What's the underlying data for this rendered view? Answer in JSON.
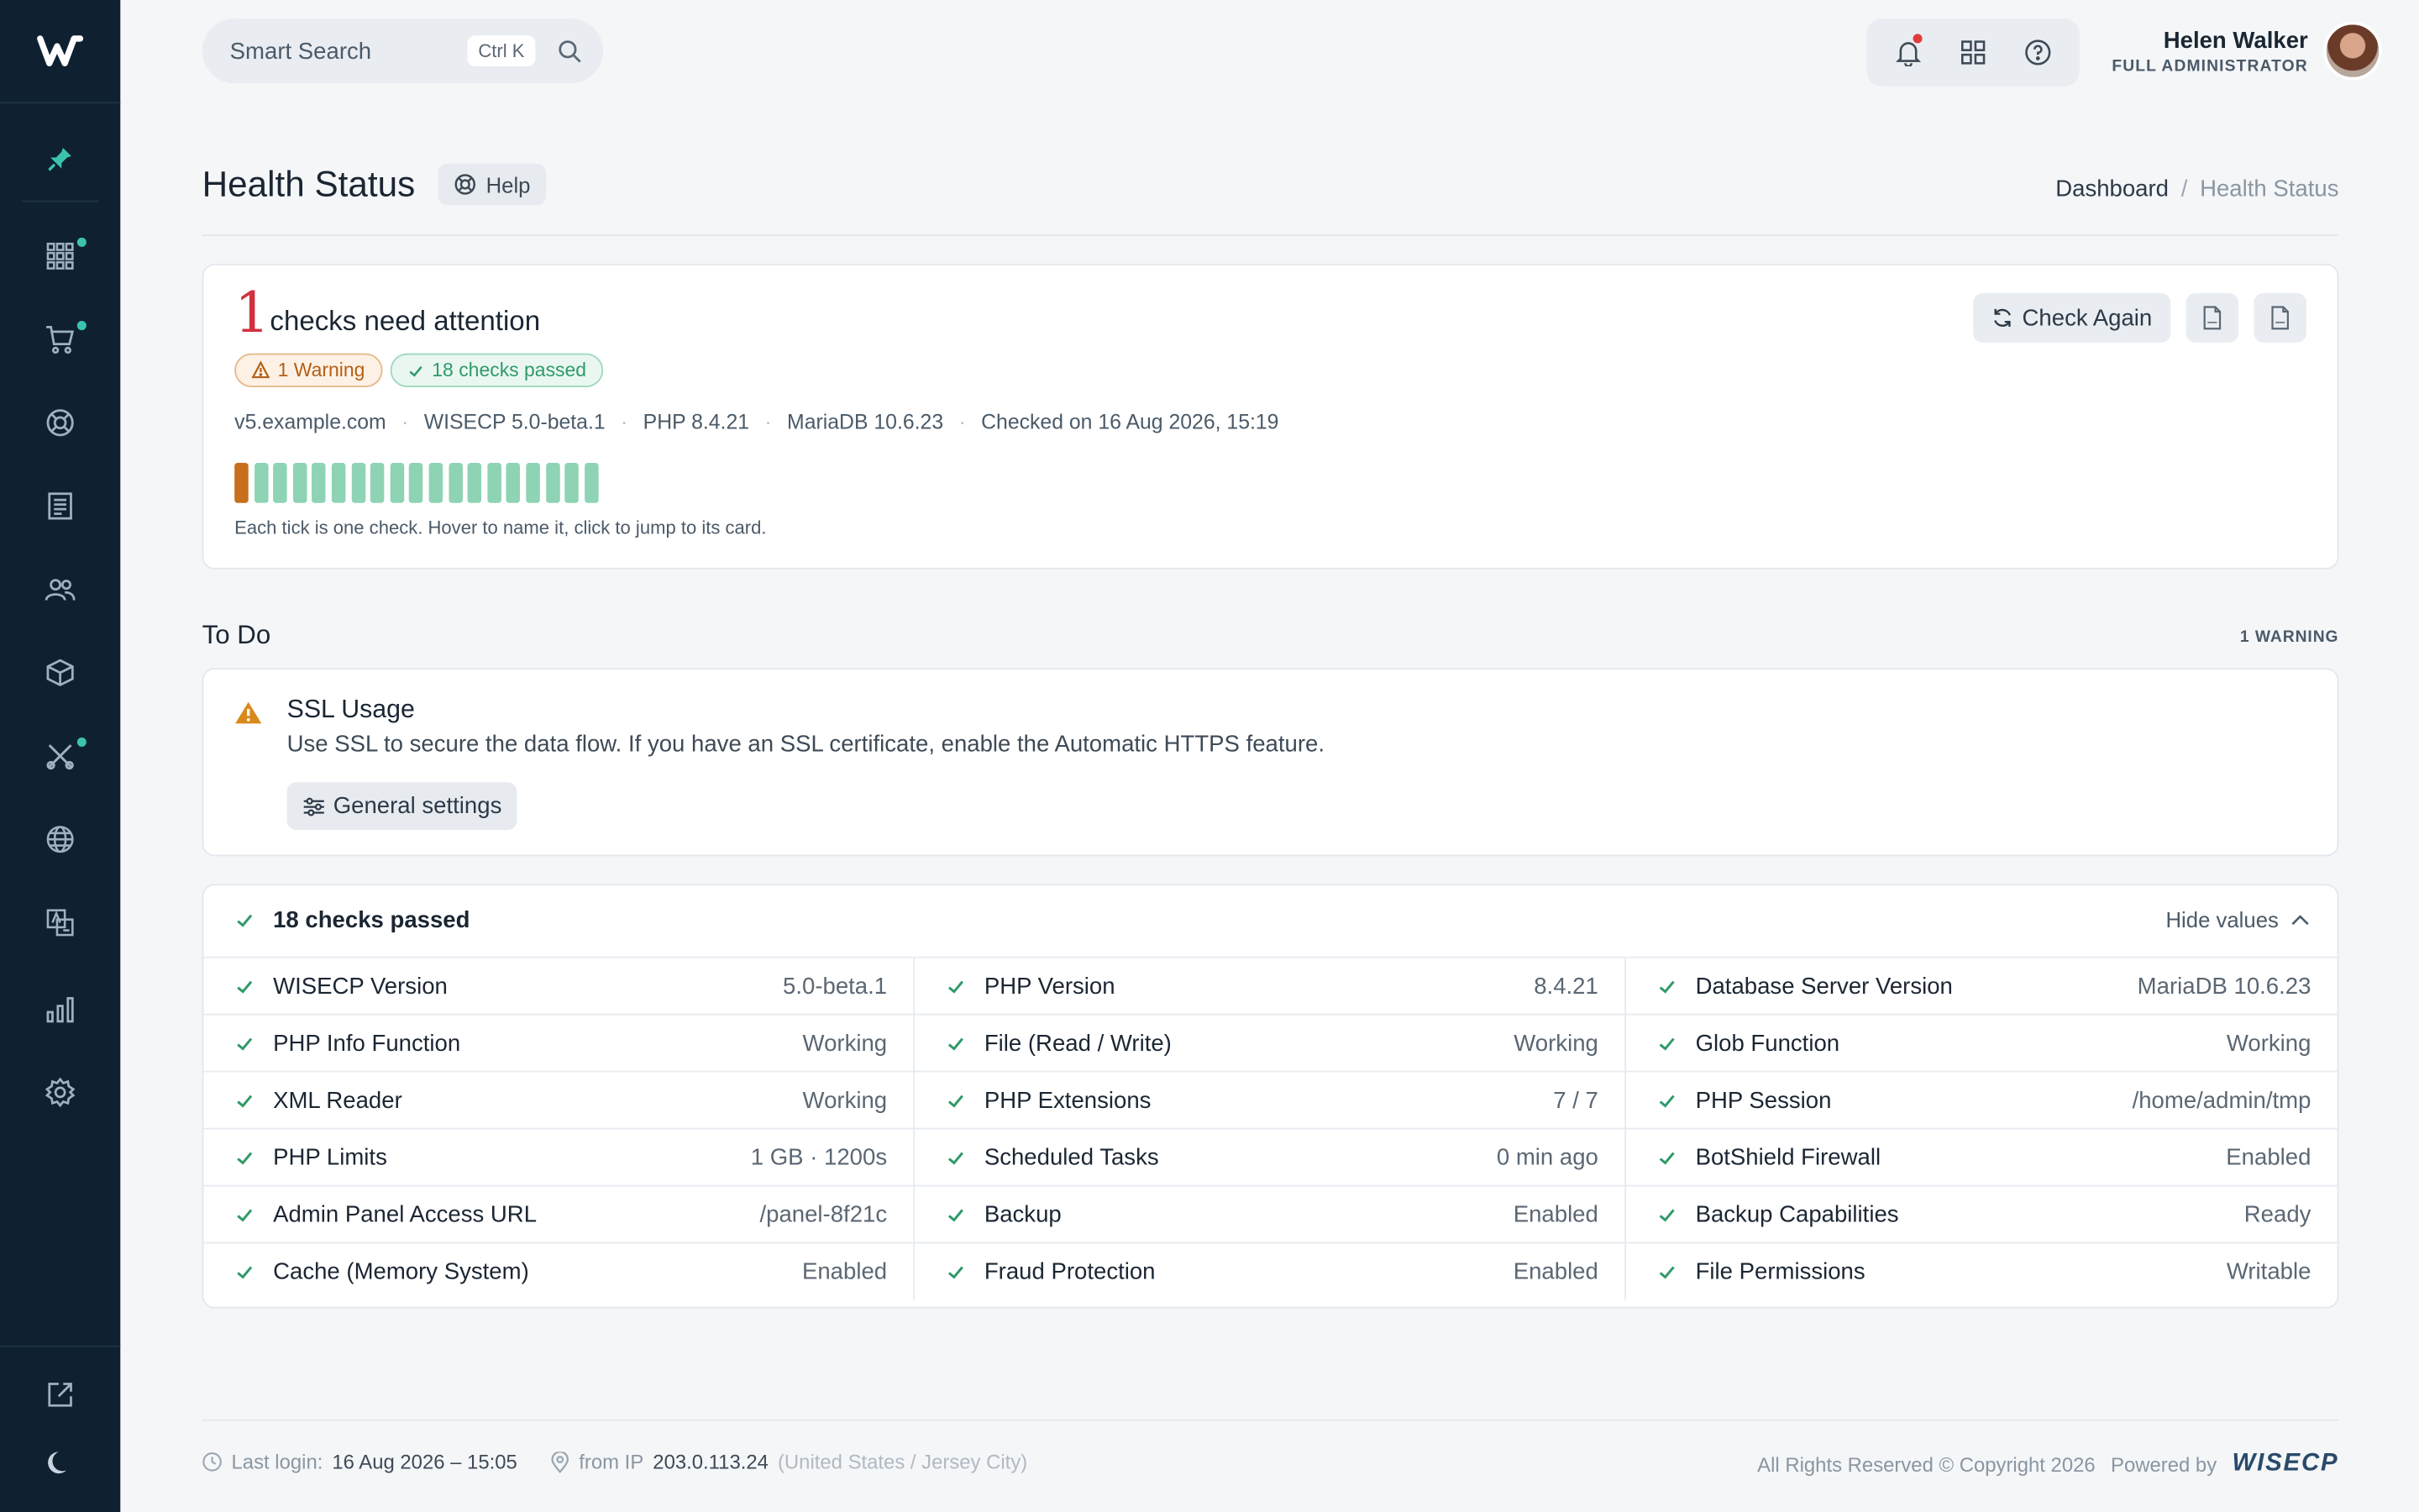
{
  "header": {
    "search_placeholder": "Smart Search",
    "search_shortcut": "Ctrl K",
    "user_name": "Helen Walker",
    "user_role": "FULL ADMINISTRATOR"
  },
  "page": {
    "title": "Health Status",
    "help_label": "Help",
    "breadcrumb": [
      "Dashboard",
      "/",
      "Health Status"
    ]
  },
  "summary": {
    "count": "1",
    "headline": "checks need attention",
    "warning_badge": "1 Warning",
    "passed_badge": "18 checks passed",
    "meta": [
      "v5.example.com",
      "WISECP 5.0-beta.1",
      "PHP 8.4.21",
      "MariaDB 10.6.23",
      "Checked on 16 Aug 2026, 15:19"
    ],
    "ticks": {
      "warning": 1,
      "passed": 18
    },
    "hint": "Each tick is one check. Hover to name it, click to jump to its card.",
    "check_again": "Check Again"
  },
  "todo": {
    "heading": "To Do",
    "count_label": "1 WARNING",
    "item_title": "SSL Usage",
    "item_desc": "Use SSL to secure the data flow. If you have an SSL certificate, enable the Automatic HTTPS feature.",
    "item_button": "General settings"
  },
  "passed": {
    "heading": "18 checks passed",
    "toggle": "Hide values",
    "checks": [
      {
        "label": "WISECP Version",
        "value": "5.0-beta.1"
      },
      {
        "label": "PHP Version",
        "value": "8.4.21"
      },
      {
        "label": "Database Server Version",
        "value": "MariaDB 10.6.23"
      },
      {
        "label": "PHP Info Function",
        "value": "Working"
      },
      {
        "label": "File (Read / Write)",
        "value": "Working"
      },
      {
        "label": "Glob Function",
        "value": "Working"
      },
      {
        "label": "XML Reader",
        "value": "Working"
      },
      {
        "label": "PHP Extensions",
        "value": "7 / 7"
      },
      {
        "label": "PHP Session",
        "value": "/home/admin/tmp"
      },
      {
        "label": "PHP Limits",
        "value": "1 GB · 1200s"
      },
      {
        "label": "Scheduled Tasks",
        "value": "0 min ago"
      },
      {
        "label": "BotShield Firewall",
        "value": "Enabled"
      },
      {
        "label": "Admin Panel Access URL",
        "value": "/panel-8f21c"
      },
      {
        "label": "Backup",
        "value": "Enabled"
      },
      {
        "label": "Backup Capabilities",
        "value": "Ready"
      },
      {
        "label": "Cache (Memory System)",
        "value": "Enabled"
      },
      {
        "label": "Fraud Protection",
        "value": "Enabled"
      },
      {
        "label": "File Permissions",
        "value": "Writable"
      }
    ]
  },
  "footer": {
    "last_login_label": "Last login:",
    "last_login_value": "16 Aug 2026 – 15:05",
    "ip_label": "from IP",
    "ip_value": "203.0.113.24",
    "location": "(United States / Jersey City)",
    "copyright": "All Rights Reserved © Copyright 2026",
    "powered_by": "Powered by",
    "brand": "WISECP"
  },
  "colors": {
    "sidebar": "#0f2131",
    "warning": "#c76f1d",
    "success": "#2f9a68",
    "danger": "#d0323f",
    "accent_dot": "#3cc3b0"
  }
}
